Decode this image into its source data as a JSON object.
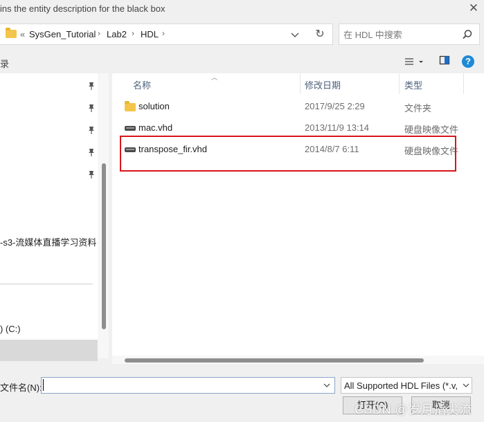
{
  "title": "ins the entity description for the black box",
  "address": {
    "breadcrumb_prefix": "«",
    "crumbs": [
      "SysGen_Tutorial",
      "Lab2",
      "HDL"
    ]
  },
  "search": {
    "placeholder": "在 HDL 中搜索"
  },
  "toolbar": {
    "organize_label": "录"
  },
  "nav": {
    "visible_item": "-s3-流媒体直播学习资料",
    "drive_item": ") (C:)"
  },
  "columns": {
    "name": "名称",
    "date": "修改日期",
    "type": "类型"
  },
  "files": [
    {
      "name": "solution",
      "date": "2017/9/25 2:29",
      "type": "文件夹",
      "icon": "folder-icon"
    },
    {
      "name": "mac.vhd",
      "date": "2013/11/9 13:14",
      "type": "硬盘映像文件",
      "icon": "disk-image-icon"
    },
    {
      "name": "transpose_fir.vhd",
      "date": "2014/8/7 6:11",
      "type": "硬盘映像文件",
      "icon": "disk-image-icon"
    }
  ],
  "bottom": {
    "filename_label": "文件名(N):",
    "filename_value": "",
    "filter_value": "All Supported HDL Files  (*.v,",
    "open_label": "打开(O)",
    "cancel_label": "取消"
  },
  "watermark": "CSDN @岁月指尖流",
  "colors": {
    "highlight": "#d7141a",
    "help": "#1e8ad6",
    "folder": "#f3c54a"
  }
}
